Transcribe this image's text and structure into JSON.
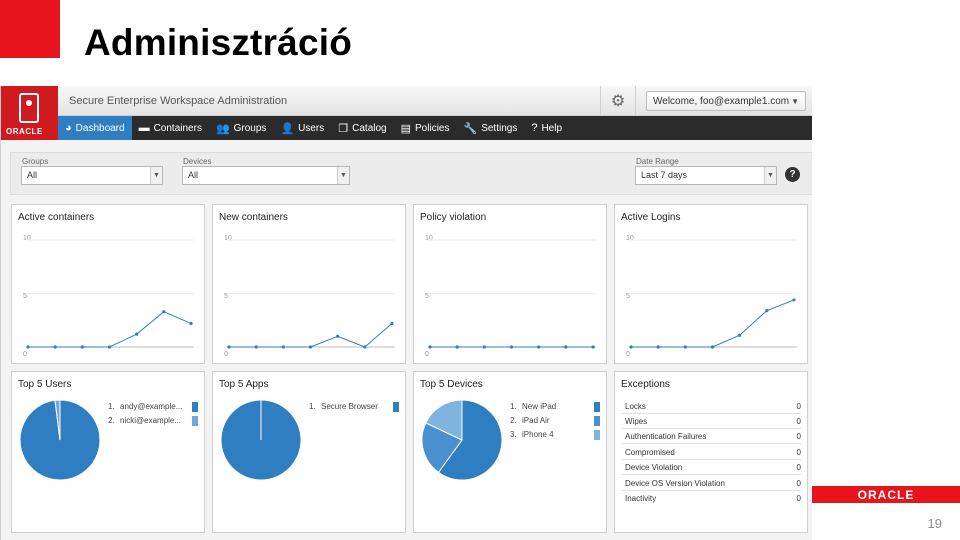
{
  "slide": {
    "title": "Adminisztráció",
    "page_number": "19",
    "footer_logo": "ORACLE"
  },
  "app": {
    "logo_text": "ORACLE",
    "title": "Secure Enterprise Workspace Administration",
    "welcome": "Welcome, foo@example1.com",
    "nav": [
      {
        "label": "Dashboard",
        "icon": "dashboard-icon",
        "active": true
      },
      {
        "label": "Containers",
        "icon": "container-icon"
      },
      {
        "label": "Groups",
        "icon": "groups-icon"
      },
      {
        "label": "Users",
        "icon": "user-icon"
      },
      {
        "label": "Catalog",
        "icon": "catalog-icon"
      },
      {
        "label": "Policies",
        "icon": "policies-icon"
      },
      {
        "label": "Settings",
        "icon": "wrench-icon"
      },
      {
        "label": "Help",
        "icon": "question-icon"
      }
    ],
    "filters": {
      "groups": {
        "label": "Groups",
        "value": "All"
      },
      "devices": {
        "label": "Devices",
        "value": "All"
      },
      "date_range": {
        "label": "Date Range",
        "value": "Last 7 days"
      }
    },
    "line_panels": [
      {
        "title": "Active containers",
        "ymax": 10,
        "ymid": 5,
        "ymin": 0,
        "values": [
          0,
          0,
          0,
          0,
          1.2,
          3.3,
          2.2
        ]
      },
      {
        "title": "New containers",
        "ymax": 10,
        "ymid": 5,
        "ymin": 0,
        "values": [
          0,
          0,
          0,
          0,
          1,
          0,
          2.2
        ]
      },
      {
        "title": "Policy violation",
        "ymax": 10,
        "ymid": 5,
        "ymin": 0,
        "values": [
          0,
          0,
          0,
          0,
          0,
          0,
          0
        ]
      },
      {
        "title": "Active Logins",
        "ymax": 10,
        "ymid": 5,
        "ymin": 0,
        "values": [
          0,
          0,
          0,
          0,
          1.1,
          3.4,
          4.4
        ]
      }
    ],
    "top_users": {
      "title": "Top 5 Users",
      "items": [
        {
          "n": "1.",
          "label": "andy@example...",
          "color": "#2f7ec2"
        },
        {
          "n": "2.",
          "label": "nicki@example...",
          "color": "#6fa8dc"
        }
      ],
      "slices": [
        0.98,
        0.02
      ]
    },
    "top_apps": {
      "title": "Top 5 Apps",
      "items": [
        {
          "n": "1.",
          "label": "Secure Browser",
          "color": "#2f7ec2"
        }
      ],
      "slices": [
        1.0
      ]
    },
    "top_devices": {
      "title": "Top 5 Devices",
      "items": [
        {
          "n": "1.",
          "label": "New iPad",
          "color": "#2f7ec2"
        },
        {
          "n": "2.",
          "label": "iPad Air",
          "color": "#4a90d0"
        },
        {
          "n": "3.",
          "label": "iPhone 4",
          "color": "#7fb3e0"
        }
      ],
      "slices": [
        0.6,
        0.22,
        0.18
      ]
    },
    "exceptions": {
      "title": "Exceptions",
      "rows": [
        {
          "label": "Locks",
          "value": "0"
        },
        {
          "label": "Wipes",
          "value": "0"
        },
        {
          "label": "Authentication Failures",
          "value": "0"
        },
        {
          "label": "Compromised",
          "value": "0"
        },
        {
          "label": "Device Violation",
          "value": "0"
        },
        {
          "label": "Device OS Version Violation",
          "value": "0"
        },
        {
          "label": "Inactivity",
          "value": "0"
        }
      ]
    }
  }
}
